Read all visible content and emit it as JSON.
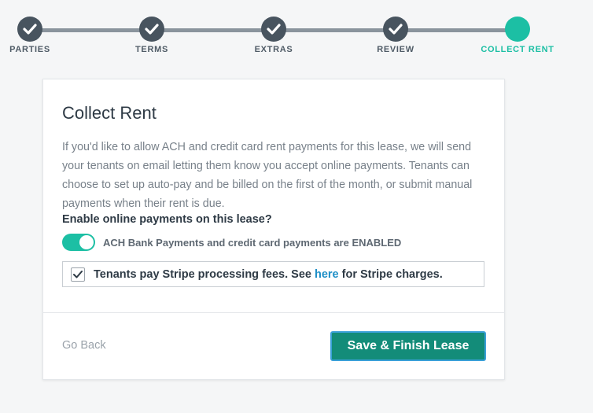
{
  "stepper": {
    "steps": [
      {
        "label": "PARTIES",
        "state": "complete"
      },
      {
        "label": "TERMS",
        "state": "complete"
      },
      {
        "label": "EXTRAS",
        "state": "complete"
      },
      {
        "label": "REVIEW",
        "state": "complete"
      },
      {
        "label": "COLLECT RENT",
        "state": "active"
      }
    ],
    "colors": {
      "complete": "#48545f",
      "active": "#1cbfa4",
      "line": "#8a949d"
    }
  },
  "card": {
    "title": "Collect Rent",
    "description": "If you'd like to allow ACH and credit card rent payments for this lease, we will send your tenants on email letting them know you accept online payments. Tenants can choose to set up auto-pay and be billed on the first of the month, or submit manual payments when their rent is due.",
    "question": "Enable online payments on this lease?",
    "toggle": {
      "on": true,
      "label": "ACH Bank Payments and credit card payments are ENABLED"
    },
    "fees": {
      "checked": true,
      "text_before": "Tenants pay Stripe processing fees. See ",
      "link_text": "here",
      "text_after": " for Stripe charges."
    },
    "footer": {
      "back_label": "Go Back",
      "finish_label": "Save & Finish Lease"
    }
  }
}
